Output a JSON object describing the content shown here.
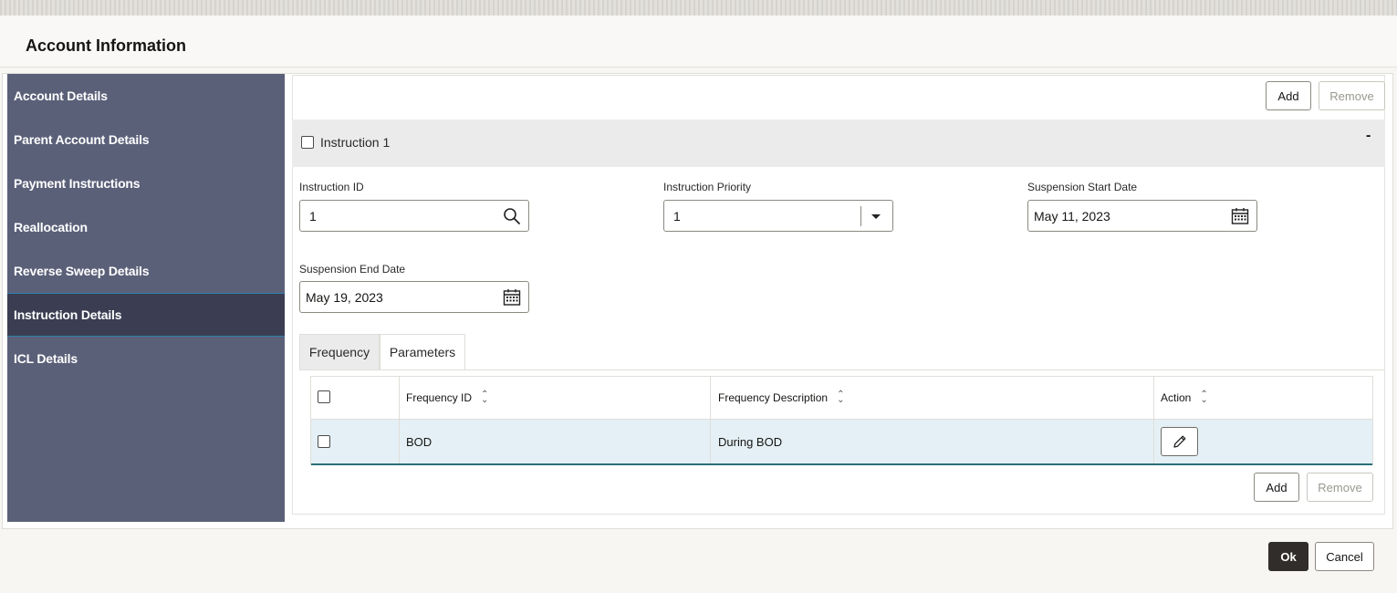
{
  "title": "Account Information",
  "sidebar": {
    "items": [
      {
        "label": "Account Details"
      },
      {
        "label": "Parent Account Details"
      },
      {
        "label": "Payment Instructions"
      },
      {
        "label": "Reallocation"
      },
      {
        "label": "Reverse Sweep Details"
      },
      {
        "label": "Instruction Details",
        "active": true
      },
      {
        "label": "ICL Details"
      }
    ]
  },
  "toolbar": {
    "add_label": "Add",
    "remove_label": "Remove"
  },
  "instruction": {
    "header_label": "Instruction 1",
    "collapse_symbol": "-",
    "fields": {
      "instruction_id": {
        "label": "Instruction ID",
        "value": "1",
        "icon": "search-icon"
      },
      "instruction_priority": {
        "label": "Instruction Priority",
        "value": "1",
        "icon": "chevron-down-icon"
      },
      "suspension_start_date": {
        "label": "Suspension Start Date",
        "value": "May 11, 2023",
        "icon": "calendar-icon"
      },
      "suspension_end_date": {
        "label": "Suspension End Date",
        "value": "May 19, 2023",
        "icon": "calendar-icon"
      }
    }
  },
  "tabs": [
    {
      "label": "Frequency",
      "active": true
    },
    {
      "label": "Parameters"
    }
  ],
  "frequency_table": {
    "columns": [
      "Frequency ID",
      "Frequency Description",
      "Action"
    ],
    "rows": [
      {
        "frequency_id": "BOD",
        "frequency_description": "During BOD",
        "action_icon": "pencil-icon"
      }
    ],
    "add_label": "Add",
    "remove_label": "Remove"
  },
  "footer": {
    "ok_label": "Ok",
    "cancel_label": "Cancel"
  }
}
